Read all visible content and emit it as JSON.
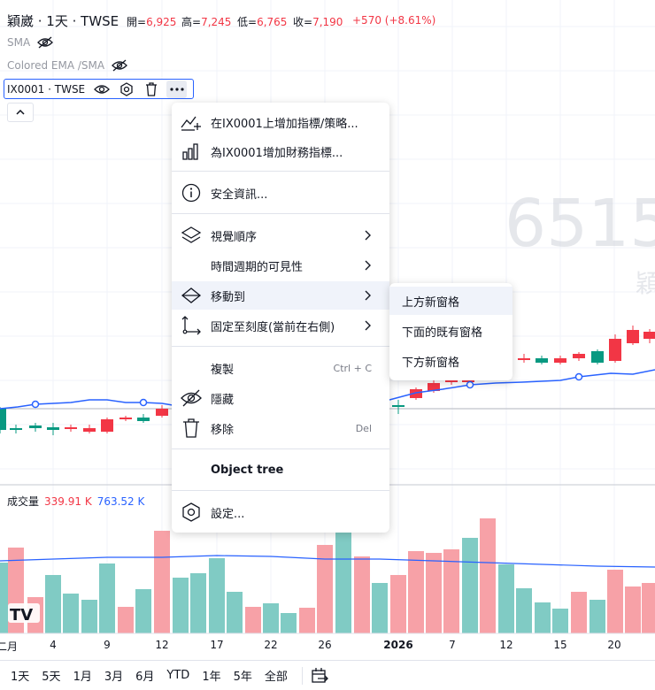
{
  "legend": {
    "title": "穎崴 · 1天 · TWSE",
    "ohlc": [
      {
        "label": "開=",
        "value": "6,925"
      },
      {
        "label": "高=",
        "value": "7,245"
      },
      {
        "label": "低=",
        "value": "6,765"
      },
      {
        "label": "收=",
        "value": "7,190"
      }
    ],
    "change": "+570 (+8.61%)"
  },
  "indicators": [
    {
      "name": "SMA",
      "icon": "eye-off-icon"
    },
    {
      "name": "Colored EMA /SMA",
      "icon": "eye-off-icon"
    }
  ],
  "series_toolbar": {
    "label": "IX0001 · TWSE",
    "icons": [
      "eye-icon",
      "settings-icon",
      "trash-icon",
      "more-icon"
    ]
  },
  "watermark": {
    "price_fragment": "6515",
    "name_fragment": "穎"
  },
  "volume_legend": {
    "label": "成交量",
    "value_red": "339.91 K",
    "value_blue": "763.52 K"
  },
  "context_menu": {
    "items": [
      {
        "label": "在IX0001上增加指標/策略...",
        "icon": "add-indicator-icon"
      },
      {
        "label": "為IX0001增加財務指標...",
        "icon": "financials-icon"
      },
      {
        "label": "安全資訊...",
        "icon": "info-icon"
      },
      {
        "label": "視覺順序",
        "icon": "layers-icon",
        "submenu": true
      },
      {
        "label": "時間週期的可見性",
        "icon": "",
        "submenu": true
      },
      {
        "label": "移動到",
        "icon": "move-to-icon",
        "submenu": true,
        "highlighted": true
      },
      {
        "label": "固定至刻度(當前在右側)",
        "icon": "pin-scale-icon",
        "submenu": true
      },
      {
        "label": "複製",
        "icon": "",
        "shortcut": "Ctrl + C"
      },
      {
        "label": "隱藏",
        "icon": "eye-off-icon"
      },
      {
        "label": "移除",
        "icon": "trash-icon",
        "shortcut": "Del"
      },
      {
        "label": "Object tree",
        "icon": ""
      },
      {
        "label": "設定...",
        "icon": "settings-icon"
      }
    ]
  },
  "submenu": {
    "items": [
      {
        "label": "上方新窗格",
        "highlighted": true
      },
      {
        "label": "下面的既有窗格"
      },
      {
        "label": "下方新窗格"
      }
    ]
  },
  "date_axis": [
    "二月",
    "4",
    "9",
    "12",
    "17",
    "22",
    "26",
    "2026",
    "7",
    "12",
    "15",
    "20"
  ],
  "range_buttons": [
    "1天",
    "5天",
    "1月",
    "3月",
    "6月",
    "YTD",
    "1年",
    "5年",
    "全部"
  ],
  "logo_text": "TV",
  "colors": {
    "up": "#089981",
    "down": "#f23645",
    "up_volume": "#80cbc4",
    "down_volume": "#f7a1a7",
    "ma_line": "#2962ff",
    "highlight": "#f0f3fa"
  }
}
